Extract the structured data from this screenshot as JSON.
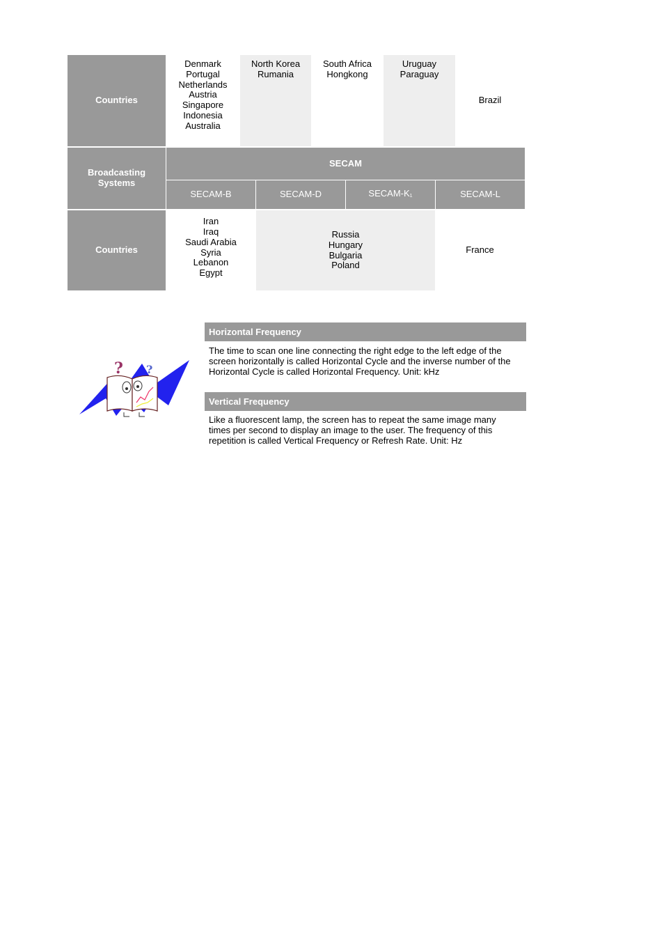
{
  "table_top": {
    "label": "Countries",
    "columns": [
      {
        "countries": [
          "Denmark",
          "Portugal",
          "Netherlands",
          "Austria",
          "Singapore",
          "Indonesia",
          "Australia"
        ]
      },
      {
        "countries": [
          "North Korea",
          "Rumania"
        ]
      },
      {
        "countries": [
          "South Africa",
          "Hongkong"
        ]
      },
      {
        "countries": [
          "Uruguay",
          "Paraguay"
        ]
      },
      {
        "countries": [
          "Brazil"
        ]
      }
    ]
  },
  "table_secam": {
    "systems_label": "Broadcasting Systems",
    "system_name": "SECAM",
    "variants": [
      {
        "label": "SECAM-B",
        "subscript": ""
      },
      {
        "label": "SECAM-D",
        "subscript": ""
      },
      {
        "label": "SECAM-K",
        "subscript": "1"
      },
      {
        "label": "SECAM-L",
        "subscript": ""
      }
    ],
    "countries_label": "Countries",
    "country_groups": [
      {
        "countries": [
          "Iran",
          "Iraq",
          "Saudi Arabia",
          "Syria",
          "Lebanon",
          "Egypt"
        ]
      },
      {
        "countries": [
          "Russia",
          "Hungary",
          "Bulgaria",
          "Poland"
        ]
      },
      {
        "countries": [
          "France"
        ]
      }
    ]
  },
  "frequency": {
    "illustration": "confused-reader-book-icon",
    "sections": [
      {
        "title": "Horizontal Frequency",
        "lines": [
          "The time to scan one line connecting the right edge to the left edge of the",
          "screen horizontally is called Horizontal Cycle and the inverse number of the",
          "Horizontal Cycle is called Horizontal Frequency. Unit: kHz"
        ]
      },
      {
        "title": "Vertical Frequency",
        "lines": [
          "Like a fluorescent lamp, the screen has to repeat the same image many",
          "times per second to display an image to the user. The frequency of this",
          "repetition is called Vertical Frequency or Refresh Rate. Unit: Hz"
        ]
      }
    ]
  },
  "colors": {
    "header_gray": "#999999",
    "shade_light": "#eeeeee",
    "illustration_blue": "#2222ee",
    "question_mark_purple": "#993366"
  }
}
